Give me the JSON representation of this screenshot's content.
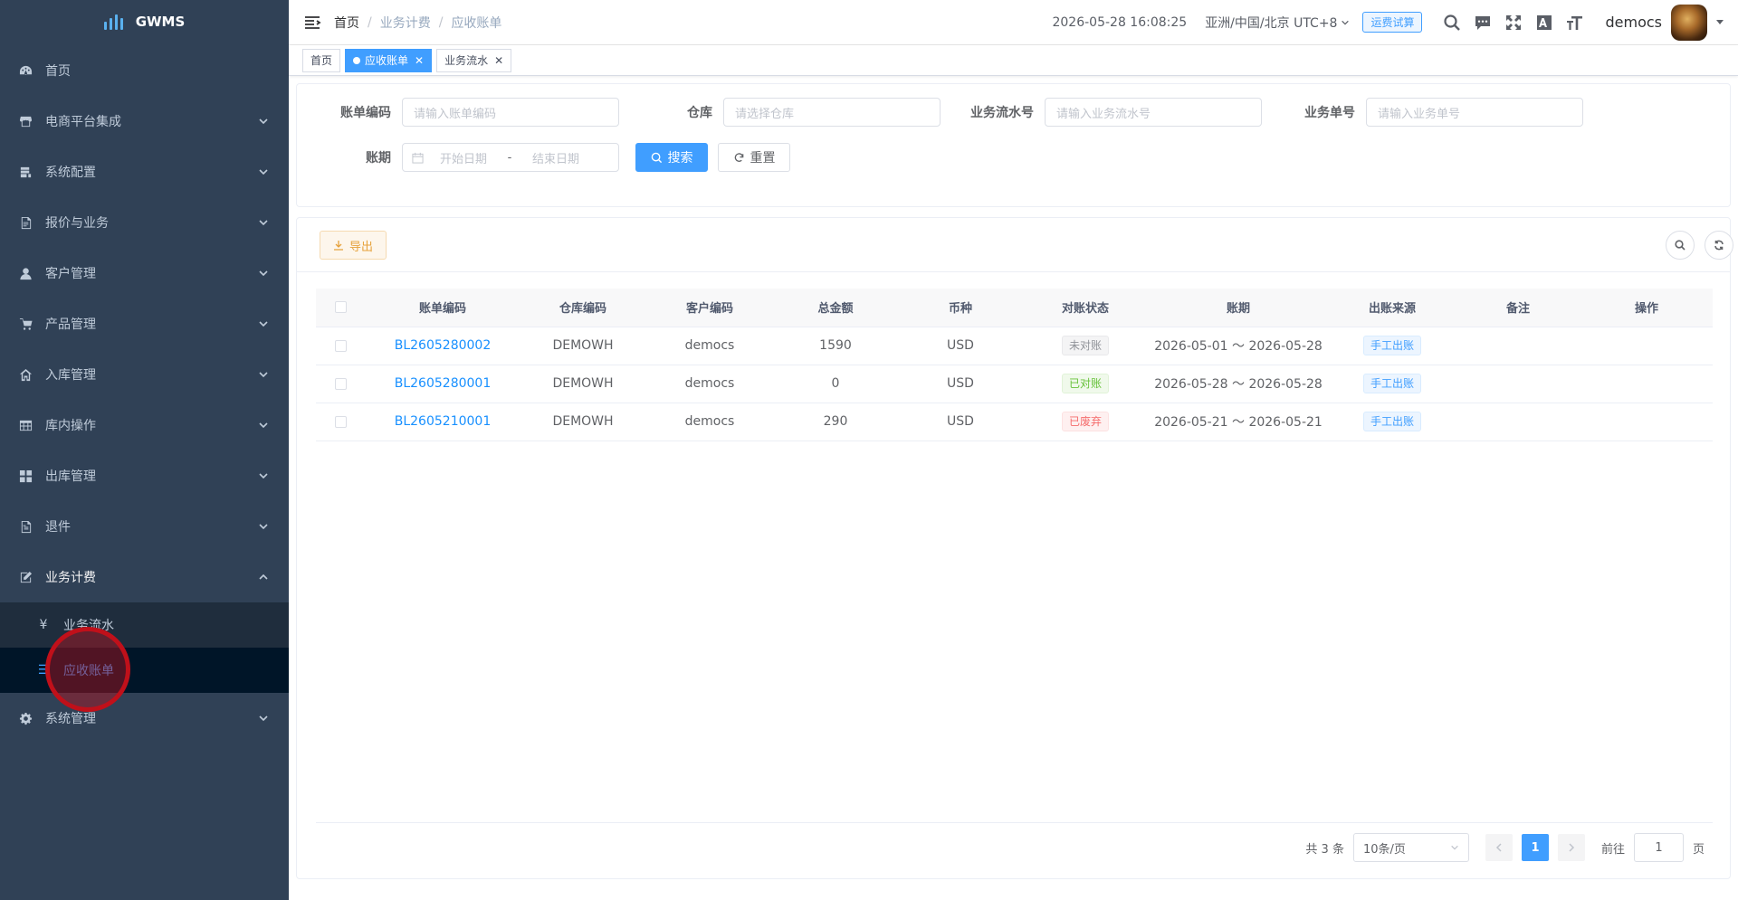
{
  "sidebar": {
    "logo_text": "GWMS",
    "items": [
      {
        "label": "首页",
        "icon": "dashboard-icon"
      },
      {
        "label": "电商平台集成",
        "icon": "store-icon"
      },
      {
        "label": "系统配置",
        "icon": "config-icon"
      },
      {
        "label": "报价与业务",
        "icon": "quote-icon"
      },
      {
        "label": "客户管理",
        "icon": "user-icon"
      },
      {
        "label": "产品管理",
        "icon": "cart-icon"
      },
      {
        "label": "入库管理",
        "icon": "home-icon"
      },
      {
        "label": "库内操作",
        "icon": "table-icon"
      },
      {
        "label": "出库管理",
        "icon": "grid-icon"
      },
      {
        "label": "退件",
        "icon": "return-icon"
      },
      {
        "label": "业务计费",
        "icon": "edit-icon"
      },
      {
        "label": "系统管理",
        "icon": "gear-icon"
      }
    ],
    "sub_items": [
      {
        "label": "业务流水",
        "icon": "¥"
      },
      {
        "label": "应收账单",
        "icon": "☰"
      }
    ]
  },
  "navbar": {
    "breadcrumb": [
      "首页",
      "业务计费",
      "应收账单"
    ],
    "datetime": "2026-05-28 16:08:25",
    "timezone": "亚洲/中国/北京 UTC+8",
    "fee_button": "运费试算",
    "username": "democs"
  },
  "tags": [
    {
      "label": "首页"
    },
    {
      "label": "应收账单"
    },
    {
      "label": "业务流水"
    }
  ],
  "search": {
    "bill_code_label": "账单编码",
    "bill_code_placeholder": "请输入账单编码",
    "warehouse_label": "仓库",
    "warehouse_placeholder": "请选择仓库",
    "flow_no_label": "业务流水号",
    "flow_no_placeholder": "请输入业务流水号",
    "biz_no_label": "业务单号",
    "biz_no_placeholder": "请输入业务单号",
    "period_label": "账期",
    "start_placeholder": "开始日期",
    "range_sep": "-",
    "end_placeholder": "结束日期",
    "search_btn": "搜索",
    "reset_btn": "重置"
  },
  "toolbar": {
    "export_btn": "导出"
  },
  "table": {
    "headers": [
      "账单编码",
      "仓库编码",
      "客户编码",
      "总金额",
      "币种",
      "对账状态",
      "账期",
      "出账来源",
      "备注",
      "操作"
    ],
    "rows": [
      {
        "code": "BL2605280002",
        "warehouse": "DEMOWH",
        "customer": "democs",
        "amount": "1590",
        "currency": "USD",
        "status": "未对账",
        "status_type": "info",
        "period": "2026-05-01 ～ 2026-05-28",
        "source": "手工出账",
        "remark": "",
        "op": ""
      },
      {
        "code": "BL2605280001",
        "warehouse": "DEMOWH",
        "customer": "democs",
        "amount": "0",
        "currency": "USD",
        "status": "已对账",
        "status_type": "success",
        "period": "2026-05-28 ～ 2026-05-28",
        "source": "手工出账",
        "remark": "",
        "op": ""
      },
      {
        "code": "BL2605210001",
        "warehouse": "DEMOWH",
        "customer": "democs",
        "amount": "290",
        "currency": "USD",
        "status": "已废弃",
        "status_type": "danger",
        "period": "2026-05-21 ～ 2026-05-21",
        "source": "手工出账",
        "remark": "",
        "op": ""
      }
    ]
  },
  "pagination": {
    "total": "共 3 条",
    "page_size": "10条/页",
    "current": "1",
    "goto_label": "前往",
    "goto_value": "1",
    "page_suffix": "页"
  },
  "colors": {
    "sidebar_bg": "#304156",
    "primary": "#409eff",
    "active_sub_bg": "#001528"
  }
}
